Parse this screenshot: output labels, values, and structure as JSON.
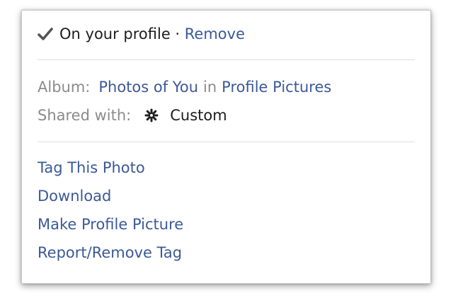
{
  "profile": {
    "status_text": "On your profile",
    "separator": " · ",
    "remove_label": "Remove"
  },
  "album": {
    "label": "Album:",
    "album_name": "Photos of You",
    "connector": "in",
    "parent_name": "Profile Pictures"
  },
  "shared": {
    "label": "Shared with:",
    "value": "Custom",
    "icon": "gear-icon"
  },
  "actions": [
    {
      "label": "Tag This Photo"
    },
    {
      "label": "Download"
    },
    {
      "label": "Make Profile Picture"
    },
    {
      "label": "Report/Remove Tag"
    }
  ],
  "colors": {
    "link": "#3b5998",
    "muted": "#8b8b8b",
    "text": "#1d1d1d",
    "divider": "#dedede"
  }
}
